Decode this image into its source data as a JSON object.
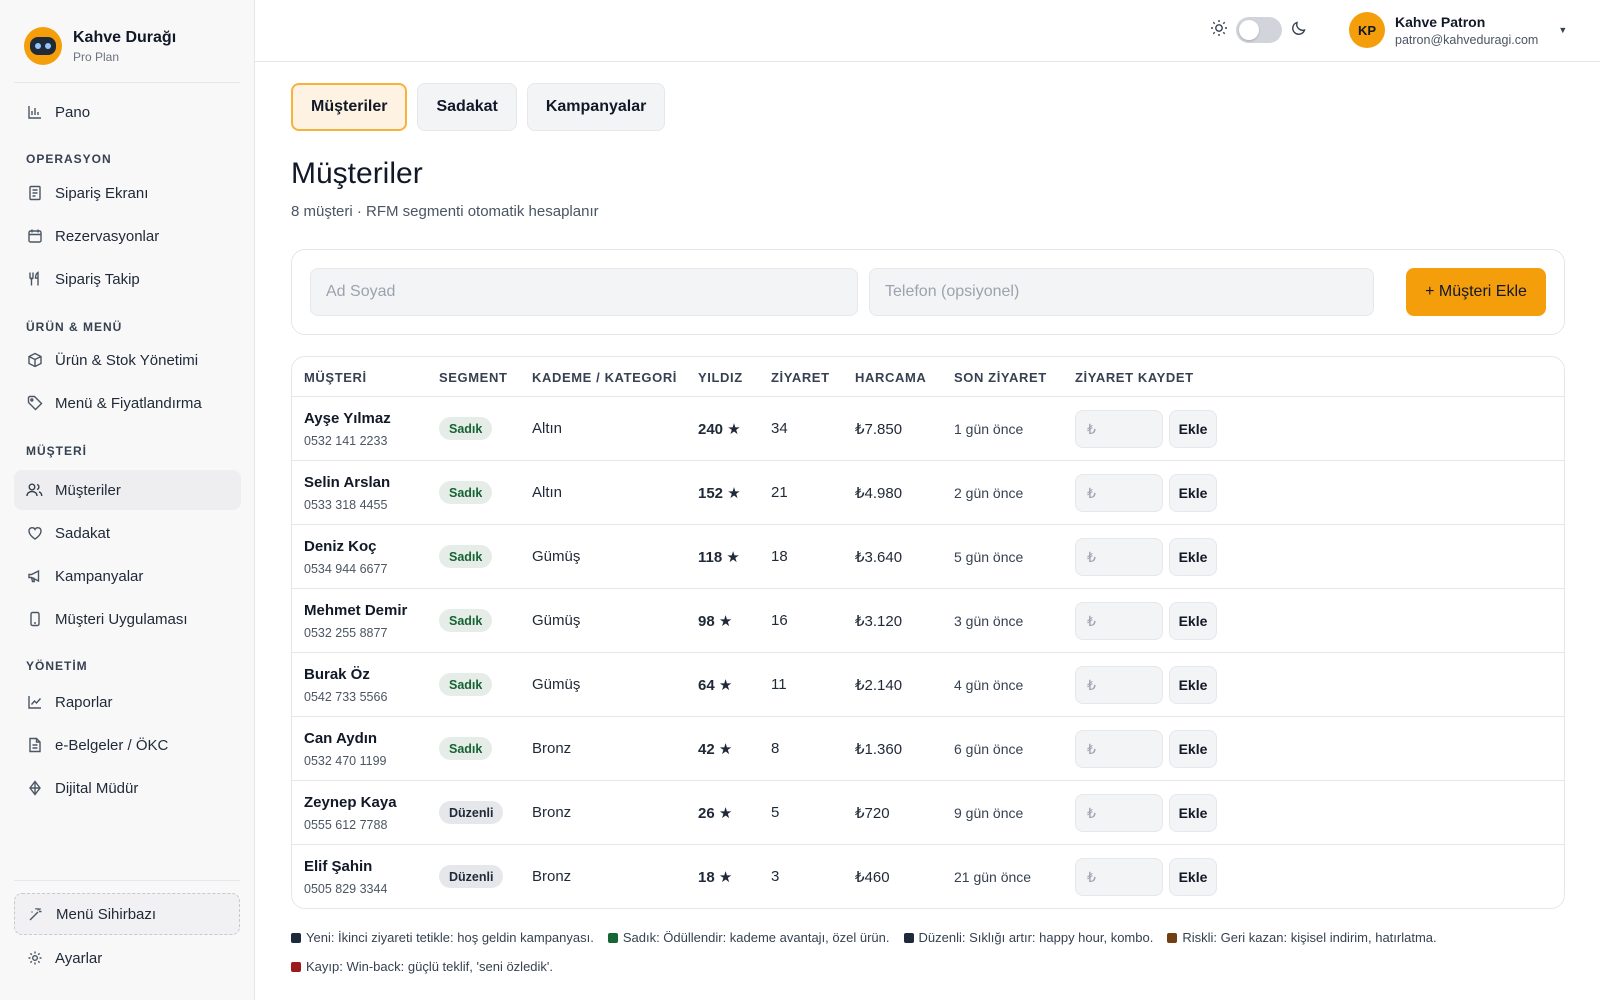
{
  "brand": {
    "name": "Kahve Durağı",
    "plan": "Pro Plan"
  },
  "sidebar": {
    "pano": "Pano",
    "sections": {
      "operasyon": "OPERASYON",
      "urun_menu": "ÜRÜN & MENÜ",
      "musteri": "MÜŞTERİ",
      "yonetim": "YÖNETİM"
    },
    "items": {
      "siparis_ekrani": "Sipariş Ekranı",
      "rezervasyonlar": "Rezervasyonlar",
      "siparis_takip": "Sipariş Takip",
      "urun_stok": "Ürün & Stok Yönetimi",
      "menu_fiyat": "Menü & Fiyatlandırma",
      "musteriler": "Müşteriler",
      "sadakat": "Sadakat",
      "kampanyalar": "Kampanyalar",
      "musteri_uygulamasi": "Müşteri Uygulaması",
      "raporlar": "Raporlar",
      "ebelgeler": "e-Belgeler / ÖKC",
      "dijital_mudur": "Dijital Müdür"
    },
    "wizard": "Menü Sihirbazı",
    "settings": "Ayarlar"
  },
  "topbar": {
    "user_initials": "KP",
    "user_name": "Kahve Patron",
    "user_email": "patron@kahveduragi.com"
  },
  "tabs": [
    "Müşteriler",
    "Sadakat",
    "Kampanyalar"
  ],
  "page": {
    "title": "Müşteriler",
    "subtitle": "8 müşteri · RFM segmenti otomatik hesaplanır"
  },
  "add_form": {
    "name_placeholder": "Ad Soyad",
    "phone_placeholder": "Telefon (opsiyonel)",
    "add_button": "+ Müşteri Ekle"
  },
  "table": {
    "headers": [
      "MÜŞTERİ",
      "SEGMENT",
      "KADEME / KATEGORİ",
      "YILDIZ",
      "ZİYARET",
      "HARCAMA",
      "SON ZİYARET",
      "ZİYARET KAYDET"
    ],
    "visit_placeholder": "₺",
    "visit_button": "Ekle",
    "rows": [
      {
        "name": "Ayşe Yılmaz",
        "phone": "0532 141 2233",
        "segment": "Sadık",
        "tier": "Altın",
        "stars": "240 ★",
        "visits": "34",
        "spend": "₺7.850",
        "last": "1 gün önce"
      },
      {
        "name": "Selin Arslan",
        "phone": "0533 318 4455",
        "segment": "Sadık",
        "tier": "Altın",
        "stars": "152 ★",
        "visits": "21",
        "spend": "₺4.980",
        "last": "2 gün önce"
      },
      {
        "name": "Deniz Koç",
        "phone": "0534 944 6677",
        "segment": "Sadık",
        "tier": "Gümüş",
        "stars": "118 ★",
        "visits": "18",
        "spend": "₺3.640",
        "last": "5 gün önce"
      },
      {
        "name": "Mehmet Demir",
        "phone": "0532 255 8877",
        "segment": "Sadık",
        "tier": "Gümüş",
        "stars": "98 ★",
        "visits": "16",
        "spend": "₺3.120",
        "last": "3 gün önce"
      },
      {
        "name": "Burak Öz",
        "phone": "0542 733 5566",
        "segment": "Sadık",
        "tier": "Gümüş",
        "stars": "64 ★",
        "visits": "11",
        "spend": "₺2.140",
        "last": "4 gün önce"
      },
      {
        "name": "Can Aydın",
        "phone": "0532 470 1199",
        "segment": "Sadık",
        "tier": "Bronz",
        "stars": "42 ★",
        "visits": "8",
        "spend": "₺1.360",
        "last": "6 gün önce"
      },
      {
        "name": "Zeynep Kaya",
        "phone": "0555 612 7788",
        "segment": "Düzenli",
        "tier": "Bronz",
        "stars": "26 ★",
        "visits": "5",
        "spend": "₺720",
        "last": "9 gün önce"
      },
      {
        "name": "Elif Şahin",
        "phone": "0505 829 3344",
        "segment": "Düzenli",
        "tier": "Bronz",
        "stars": "18 ★",
        "visits": "3",
        "spend": "₺460",
        "last": "21 gün önce"
      }
    ]
  },
  "legend": [
    {
      "text": "Yeni: İkinci ziyareti tetikle: hoş geldin kampanyası.",
      "color": "#1e293b"
    },
    {
      "text": "Sadık: Ödüllendir: kademe avantajı, özel ürün.",
      "color": "#166534"
    },
    {
      "text": "Düzenli: Sıklığı artır: happy hour, kombo.",
      "color": "#1e293b"
    },
    {
      "text": "Riskli: Geri kazan: kişisel indirim, hatırlatma.",
      "color": "#713f12"
    },
    {
      "text": "Kayıp: Win-back: güçlü teklif, 'seni özledik'.",
      "color": "#991b1b"
    }
  ],
  "colors": {
    "accent": "#f59e0b",
    "sadik_badge_text": "#166534"
  }
}
